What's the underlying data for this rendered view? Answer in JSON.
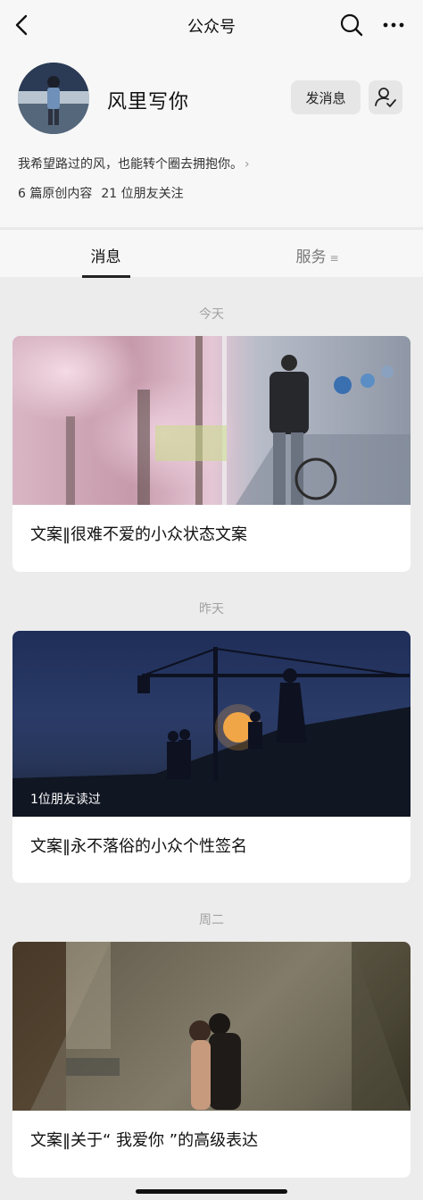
{
  "nav": {
    "title": "公众号",
    "back_icon": "chevron-left-icon",
    "search_icon": "search-icon",
    "more_icon": "more-dots-icon"
  },
  "account": {
    "name": "风里写你",
    "send_message_label": "发消息",
    "bio": "我希望路过的风，也能转个圈去拥抱你。",
    "original_count": "6 篇原创内容",
    "friends_following": "21 位朋友关注"
  },
  "tabs": [
    {
      "label": "消息",
      "active": true
    },
    {
      "label": "服务",
      "active": false
    }
  ],
  "feed": [
    {
      "date": "今天",
      "title": "文案‖很难不爱的小众状态文案",
      "badge": ""
    },
    {
      "date": "昨天",
      "title": "文案‖永不落俗的小众个性签名",
      "badge": "1位朋友读过"
    },
    {
      "date": "周二",
      "title": "文案‖关于“ 我爱你 ”的高级表达",
      "badge": ""
    }
  ],
  "colors": {
    "page_bg": "#ececec",
    "header_bg": "#f7f7f7",
    "card_bg": "#ffffff",
    "button_bg": "#e6e6e6"
  }
}
